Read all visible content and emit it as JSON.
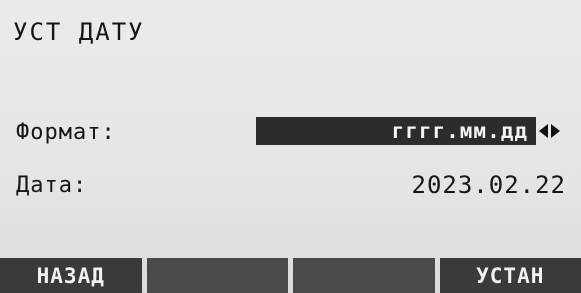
{
  "screen": {
    "title": "УСТ ДАТУ"
  },
  "fields": {
    "format_label": "Формат:",
    "format_value": "гггг.мм.дд",
    "date_label": "Дата:",
    "date_value": "2023.02.22"
  },
  "icons": {
    "selector_arrows": "left-right-arrows-icon"
  },
  "softkeys": {
    "f1": "НАЗАД",
    "f2": "",
    "f3": "",
    "f4": "УСТАН"
  },
  "colors": {
    "background": "#e6e6e6",
    "highlight": "#2c2c2c",
    "softkey": "#3a3a3a",
    "softkey_text": "#f2f2f2"
  }
}
